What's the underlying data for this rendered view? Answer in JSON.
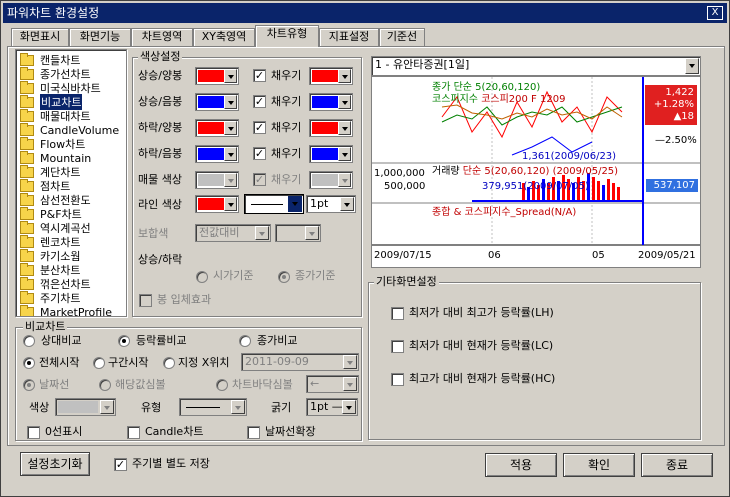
{
  "window": {
    "title": "파워차트 환경설정",
    "close": "X"
  },
  "tabs": [
    "화면표시",
    "화면기능",
    "차트영역",
    "XY축영역",
    "차트유형",
    "지표설정",
    "기준선"
  ],
  "tree": [
    "캔들차트",
    "종가선차트",
    "미국식바차트",
    "비교차트",
    "매물대차트",
    "CandleVolume",
    "Flow차트",
    "Mountain",
    "계단차트",
    "점차트",
    "삼선전환도",
    "P&F차트",
    "역시계곡선",
    "렌코차트",
    "카기소웜",
    "분산차트",
    "꺾은선차트",
    "주기차트",
    "MarketProfile"
  ],
  "color": {
    "title": "색상설정",
    "rows": [
      {
        "label": "상승/양봉",
        "fill": "채우기"
      },
      {
        "label": "상승/음봉",
        "fill": "채우기"
      },
      {
        "label": "하락/양봉",
        "fill": "채우기"
      },
      {
        "label": "하락/음봉",
        "fill": "채우기"
      },
      {
        "label": "매물 색상",
        "fill": "채우기"
      }
    ],
    "line_label": "라인 색상",
    "line_width": "1pt",
    "combined_label": "보합색",
    "combined_value": "전값대비",
    "updown_label": "상승/하락",
    "opt_time": "시가기준",
    "opt_close": "종가기준",
    "solid_label": "봉 입체효과"
  },
  "compare": {
    "title": "비교차트",
    "type_opts": [
      "상대비교",
      "등락률비교",
      "종가비교"
    ],
    "start_opts": [
      "전체시작",
      "구간시작",
      "지정 X위치"
    ],
    "date_value": "2011-09-09",
    "marker_opts": [
      "날짜선",
      "해당값심볼",
      "차트바닥심볼"
    ],
    "color_label": "색상",
    "type_label": "유형",
    "width_label": "굵기",
    "width_value": "1pt",
    "check_zero": "0선표시",
    "check_candle": "Candle차트",
    "check_date": "날짜선확장"
  },
  "preview": {
    "combo": "1 - 유안타증권[1일]",
    "top_legend": [
      "종가 단순 5(20,60,120)",
      "코스피지수",
      "코스피200 F 1209"
    ],
    "price_tag": [
      "1,422",
      "+1.28%",
      "▲18"
    ],
    "pct_label": "2.50%",
    "min_label": "1,361(2009/06/23)",
    "vol_axis": [
      "1,000,000",
      "500,000"
    ],
    "vol_legend": [
      "거래량",
      "단순 5(20,60,120)"
    ],
    "vol_min": "379,951(2009/07/05)",
    "vol_max": "(2009/05/25)",
    "vol_tag": "537,107",
    "spread_legend": "종합 & 코스피지수_Spread(N/A)",
    "x_labels": [
      "2009/07/15",
      "06",
      "05",
      "2009/05/21"
    ]
  },
  "other": {
    "title": "기타화면설정",
    "items": [
      "최저가 대비 최고가 등락률(LH)",
      "최저가 대비 현재가 등락률(LC)",
      "최고가 대비 현재가 등락률(HC)"
    ]
  },
  "footer": {
    "reset": "설정초기화",
    "save_label": "주기별 별도 저장",
    "apply": "적용",
    "ok": "확인",
    "close": "종료"
  },
  "colors": {
    "red": "#ff0000",
    "blue": "#0000ff",
    "gray": "#c0c0c0",
    "titlebar": "#0a246a",
    "tag_red": "#e02020",
    "tag_blue": "#3070e0"
  }
}
